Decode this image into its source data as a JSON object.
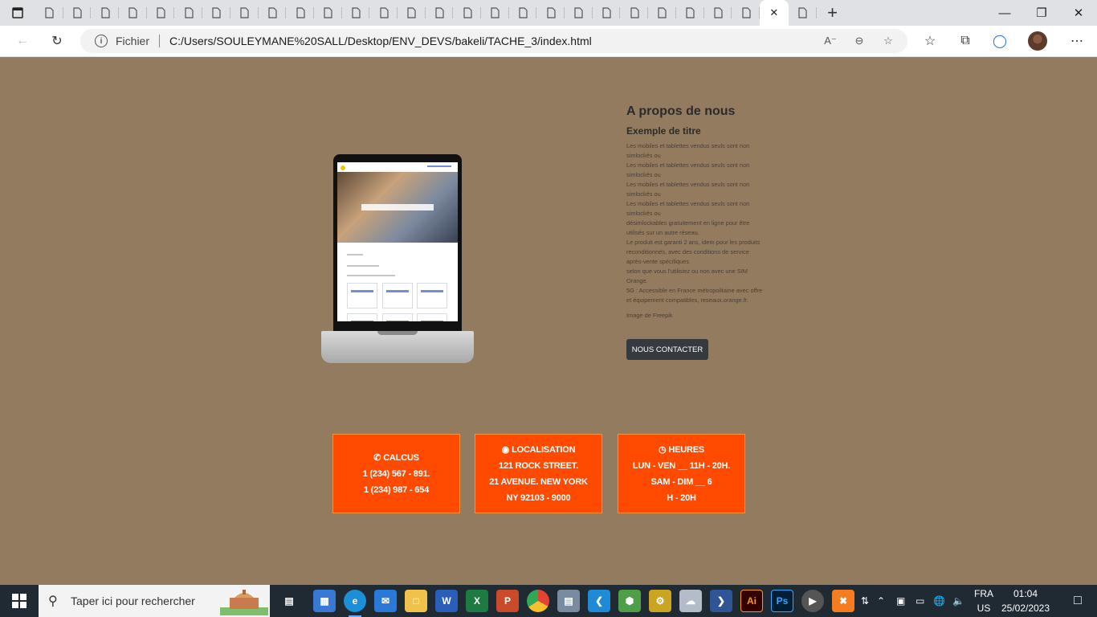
{
  "browser": {
    "tabs_count": 28,
    "new_tab_label": "+",
    "address": {
      "prefix": "Fichier",
      "url": "C:/Users/SOULEYMANE%20SALL/Desktop/ENV_DEVS/bakeli/TACHE_3/index.html"
    }
  },
  "about": {
    "title": "A propos de nous",
    "subtitle": "Exemple de titre",
    "lines": [
      "Les mobiles et tablettes vendus seuls sont non",
      "simlockés ou",
      "Les mobiles et tablettes vendus seuls sont non",
      "simlockés ou",
      "Les mobiles et tablettes vendus seuls sont non",
      "simlockés ou",
      "Les mobiles et tablettes vendus seuls sont non",
      "simlockés ou",
      "désimlockables gratuitement en ligne pour être",
      "utilisés sur un autre réseau.",
      "Le produit est garanti 2 ans, idem pour les produits",
      "reconditionnés, avec des conditions de service",
      "après-vente spécifiques",
      "selon que vous l'utilisiez ou non avec une SIM",
      "Orange.",
      "5G : Accessible en France métropolitaine avec offre",
      "et équipement compatibles, reseaux.orange.fr."
    ],
    "credit": "Image de Freepik",
    "button": "NOUS CONTACTER"
  },
  "info_boxes": [
    {
      "title": "CALCUS",
      "icon": "phone-icon",
      "lines": [
        "1 (234) 567 - 891.",
        "1 (234) 987 - 654"
      ]
    },
    {
      "title": "LOCALISATION",
      "icon": "map-pin-icon",
      "lines": [
        "121 ROCK STREET.",
        "21 AVENUE. NEW YORK",
        "NY 92103 - 9000"
      ]
    },
    {
      "title": "HEURES",
      "icon": "clock-icon",
      "lines": [
        "LUN - VEN __ 11H - 20H.",
        "SAM - DIM __ 6",
        "H - 20H"
      ]
    }
  ],
  "taskbar": {
    "search_placeholder": "Taper ici pour rechercher",
    "language": "FRA",
    "region": "US",
    "time": "01:04",
    "date": "25/02/2023"
  },
  "colors": {
    "page_bg": "#937b5f",
    "info_box": "#ff4a00",
    "button": "#343a40"
  }
}
